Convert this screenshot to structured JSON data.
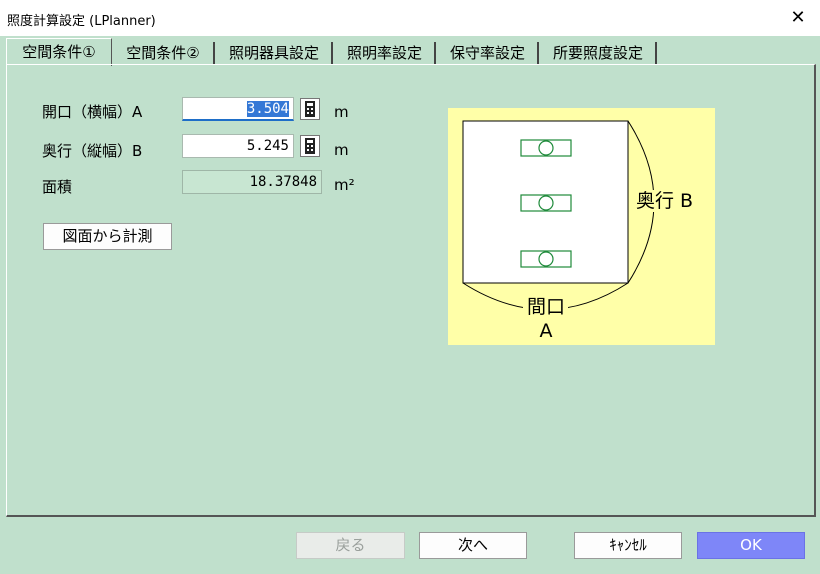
{
  "window": {
    "title": "照度計算設定 (LPlanner)",
    "close_glyph": "✕"
  },
  "tabs": [
    {
      "label": "空間条件①",
      "active": true
    },
    {
      "label": "空間条件②",
      "active": false
    },
    {
      "label": "照明器具設定",
      "active": false
    },
    {
      "label": "照明率設定",
      "active": false
    },
    {
      "label": "保守率設定",
      "active": false
    },
    {
      "label": "所要照度設定",
      "active": false
    }
  ],
  "form": {
    "width": {
      "label": "開口（横幅）A",
      "value": "3.504",
      "unit": "m"
    },
    "depth": {
      "label": "奥行（縦幅）B",
      "value": "5.245",
      "unit": "m"
    },
    "area": {
      "label": "面積",
      "value": "18.37848",
      "unit": "m²"
    },
    "measure_button": "図面から計測"
  },
  "diagram": {
    "depth_label": "奥行 B",
    "width_label_1": "間口",
    "width_label_2": "A",
    "fixtures_count": 3
  },
  "footer": {
    "back": "戻る",
    "next": "次へ",
    "cancel": "ｷｬﾝｾﾙ",
    "ok": "OK"
  },
  "colors": {
    "dialog_bg": "#c0e0cc",
    "diagram_bg": "#ffffa8",
    "fixture": "#1e8a3a",
    "ok_button": "#7e86f8"
  },
  "icons": {
    "calculator": "calculator-icon",
    "close": "close-icon"
  }
}
